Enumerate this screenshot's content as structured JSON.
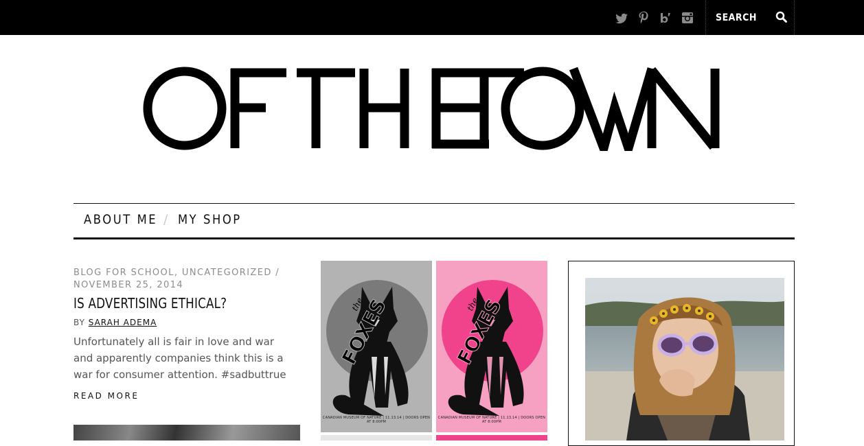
{
  "header": {
    "social": [
      "twitter-icon",
      "pinterest-icon",
      "bloglovin-icon",
      "instagram-icon"
    ],
    "search": {
      "placeholder": "SEARCH"
    }
  },
  "site": {
    "logo_text": "OF THE TOWN"
  },
  "nav": {
    "items": [
      {
        "label": "ABOUT ME"
      },
      {
        "label": "MY SHOP"
      }
    ],
    "separator": "/"
  },
  "post": {
    "category_1": "BLOG FOR SCHOOL",
    "category_2": "UNCATEGORIZED",
    "date": "NOVEMBER 25, 2014",
    "title": "IS ADVERTISING ETHICAL?",
    "by_label": "BY",
    "author": "SARAH ADEMA",
    "excerpt": "Unfortunately all is fair in love and war and apparently companies think this is a war for consumer attention. #sadbuttrue",
    "read_more": "READ MORE"
  },
  "posters": {
    "word": "FOXES",
    "word_prefix": "the",
    "caption": "CANADIAN MUSEUM OF NATURE | 11.13.14 | DOORS OPEN AT 8:00PM"
  },
  "colors": {
    "topbar": "#000000",
    "meta_text": "#8c8c8c",
    "poster_grey": "#b3b3b3",
    "poster_pink": "#f7a1c2",
    "poster_hot_pink": "#f0438c"
  }
}
